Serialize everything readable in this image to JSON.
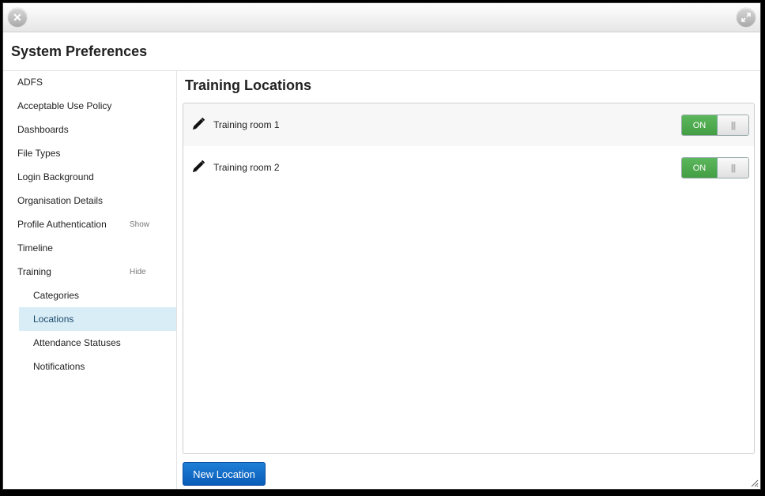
{
  "window": {
    "title": "System Preferences"
  },
  "sidebar": {
    "items": [
      {
        "label": "ADFS"
      },
      {
        "label": "Acceptable Use Policy"
      },
      {
        "label": "Dashboards"
      },
      {
        "label": "File Types"
      },
      {
        "label": "Login Background"
      },
      {
        "label": "Organisation Details"
      },
      {
        "label": "Profile Authentication",
        "toggle": "Show"
      },
      {
        "label": "Timeline"
      },
      {
        "label": "Training",
        "toggle": "Hide"
      }
    ],
    "sub_items": [
      {
        "label": "Categories"
      },
      {
        "label": "Locations",
        "active": true
      },
      {
        "label": "Attendance Statuses"
      },
      {
        "label": "Notifications"
      }
    ]
  },
  "main": {
    "title": "Training Locations",
    "locations": [
      {
        "name": "Training room 1",
        "state": "ON"
      },
      {
        "name": "Training room 2",
        "state": "ON"
      }
    ],
    "new_button": "New Location"
  },
  "colors": {
    "switch_on": "#5cb85c",
    "primary_button": "#0a5cb8",
    "active_nav": "#d9edf7"
  },
  "icons": {
    "close": "close-icon",
    "expand": "expand-icon",
    "edit": "pencil-icon",
    "resize": "resize-grip-icon"
  }
}
